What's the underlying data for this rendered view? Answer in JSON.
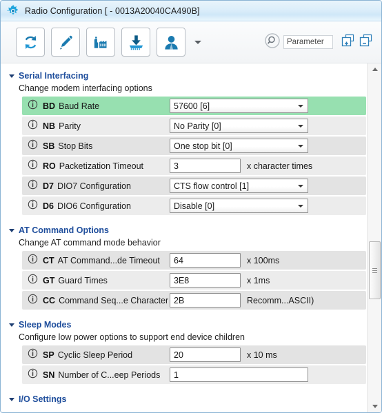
{
  "window": {
    "title": "Radio Configuration [  - 0013A20040CA490B]",
    "gear_icon": "gear-icon"
  },
  "toolbar": {
    "buttons": [
      {
        "name": "read-button",
        "icon": "refresh-arrows-icon"
      },
      {
        "name": "write-button",
        "icon": "pencil-icon"
      },
      {
        "name": "default-button",
        "icon": "factory-icon"
      },
      {
        "name": "update-firmware-button",
        "icon": "download-icon"
      },
      {
        "name": "profile-button",
        "icon": "person-icon"
      }
    ],
    "dropdown_caret": "chevron-down-icon",
    "search_icon": "search-icon",
    "parameter_placeholder": "Parameter",
    "expand_all": "expand-all-icon",
    "collapse_all": "collapse-all-icon"
  },
  "sections": [
    {
      "title": "Serial Interfacing",
      "subtitle": "Change modem interfacing options",
      "expanded": true,
      "rows": [
        {
          "code": "BD",
          "label": "Baud Rate",
          "type": "select",
          "value": "57600 [6]",
          "unit": "",
          "highlight": true
        },
        {
          "code": "NB",
          "label": "Parity",
          "type": "select",
          "value": "No Parity [0]",
          "unit": "",
          "highlight": false
        },
        {
          "code": "SB",
          "label": "Stop Bits",
          "type": "select",
          "value": "One stop bit [0]",
          "unit": "",
          "highlight": false
        },
        {
          "code": "RO",
          "label": "Packetization Timeout",
          "type": "text",
          "value": "3",
          "unit": "x character times",
          "highlight": false
        },
        {
          "code": "D7",
          "label": "DIO7 Configuration",
          "type": "select",
          "value": "CTS flow control [1]",
          "unit": "",
          "highlight": false
        },
        {
          "code": "D6",
          "label": "DIO6 Configuration",
          "type": "select",
          "value": "Disable [0]",
          "unit": "",
          "highlight": false
        }
      ]
    },
    {
      "title": "AT Command Options",
      "subtitle": "Change AT command mode behavior",
      "expanded": true,
      "rows": [
        {
          "code": "CT",
          "label": "AT Command...de Timeout",
          "type": "text",
          "value": "64",
          "unit": "x 100ms",
          "highlight": false
        },
        {
          "code": "GT",
          "label": "Guard Times",
          "type": "text",
          "value": "3E8",
          "unit": "x 1ms",
          "highlight": false
        },
        {
          "code": "CC",
          "label": "Command Seq...e Character",
          "type": "text",
          "value": "2B",
          "unit": "Recomm...ASCII)",
          "highlight": false
        }
      ]
    },
    {
      "title": "Sleep Modes",
      "subtitle": "Configure low power options to support end device children",
      "expanded": true,
      "rows": [
        {
          "code": "SP",
          "label": "Cyclic Sleep Period",
          "type": "text",
          "value": "20",
          "unit": "x 10 ms",
          "highlight": false
        },
        {
          "code": "SN",
          "label": "Number of C...eep Periods",
          "type": "text-wide",
          "value": "1",
          "unit": "",
          "highlight": false
        }
      ]
    },
    {
      "title": "I/O Settings",
      "subtitle": "",
      "expanded": true,
      "rows": []
    }
  ],
  "row_actions": {
    "refresh": "refresh-circle-icon",
    "edit": "pencil-circle-icon"
  },
  "scrollbar": {
    "up_arrow": "scroll-up-icon",
    "down_arrow": "scroll-down-icon",
    "thumb": "scroll-thumb"
  },
  "colors": {
    "accent_blue": "#1f4e9c",
    "icon_blue": "#1b7bb0",
    "highlight_green": "#97e0b0",
    "action_green": "#2f9e3f",
    "action_orange": "#c0562a",
    "row_gray": "#e3e3e3"
  }
}
